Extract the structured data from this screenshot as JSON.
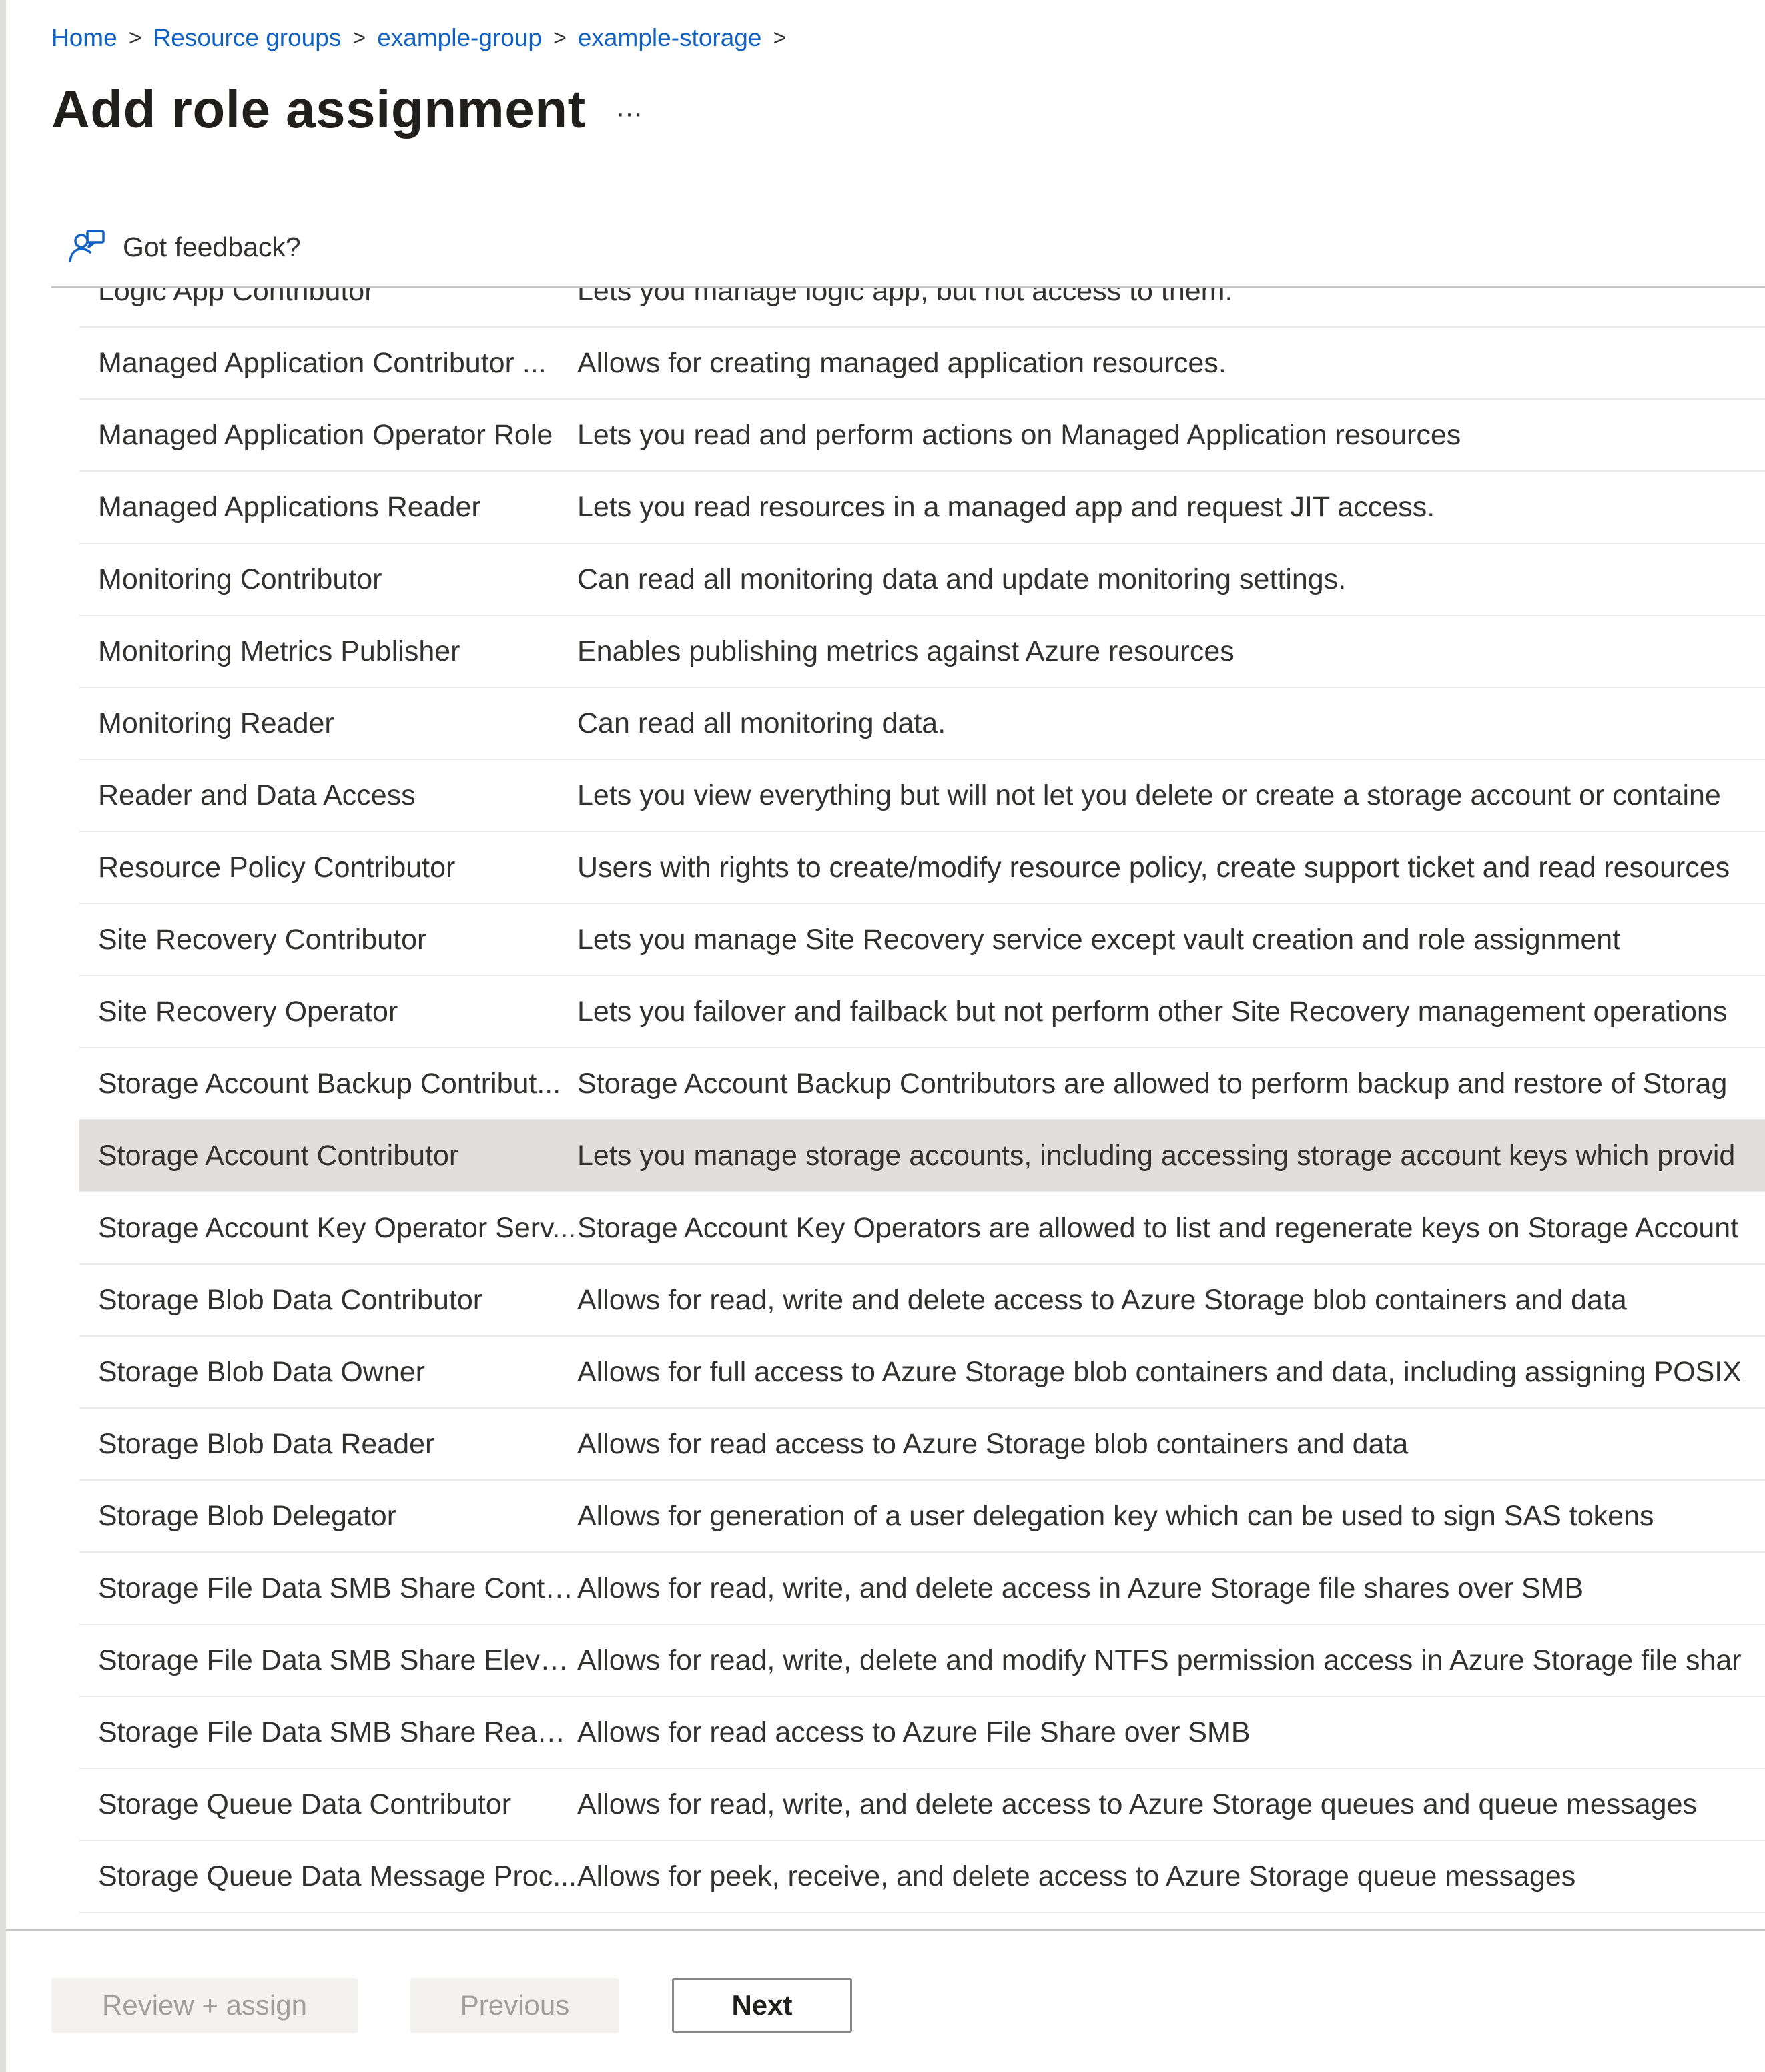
{
  "breadcrumb": {
    "items": [
      "Home",
      "Resource groups",
      "example-group",
      "example-storage"
    ],
    "separator": ">"
  },
  "header": {
    "title": "Add role assignment",
    "more_label": "···"
  },
  "feedback": {
    "label": "Got feedback?",
    "icon": "feedback-person-icon"
  },
  "roles": {
    "selected_index": 12,
    "rows": [
      {
        "name": "Logic App Contributor",
        "description": "Lets you manage logic app, but not access to them."
      },
      {
        "name": "Managed Application Contributor ...",
        "description": "Allows for creating managed application resources."
      },
      {
        "name": "Managed Application Operator Role",
        "description": "Lets you read and perform actions on Managed Application resources"
      },
      {
        "name": "Managed Applications Reader",
        "description": "Lets you read resources in a managed app and request JIT access."
      },
      {
        "name": "Monitoring Contributor",
        "description": "Can read all monitoring data and update monitoring settings."
      },
      {
        "name": "Monitoring Metrics Publisher",
        "description": "Enables publishing metrics against Azure resources"
      },
      {
        "name": "Monitoring Reader",
        "description": "Can read all monitoring data."
      },
      {
        "name": "Reader and Data Access",
        "description": "Lets you view everything but will not let you delete or create a storage account or containe"
      },
      {
        "name": "Resource Policy Contributor",
        "description": "Users with rights to create/modify resource policy, create support ticket and read resources"
      },
      {
        "name": "Site Recovery Contributor",
        "description": "Lets you manage Site Recovery service except vault creation and role assignment"
      },
      {
        "name": "Site Recovery Operator",
        "description": "Lets you failover and failback but not perform other Site Recovery management operations"
      },
      {
        "name": "Storage Account Backup Contribut...",
        "description": "Storage Account Backup Contributors are allowed to perform backup and restore of Storag"
      },
      {
        "name": "Storage Account Contributor",
        "description": "Lets you manage storage accounts, including accessing storage account keys which provid"
      },
      {
        "name": "Storage Account Key Operator Serv...",
        "description": "Storage Account Key Operators are allowed to list and regenerate keys on Storage Account"
      },
      {
        "name": "Storage Blob Data Contributor",
        "description": "Allows for read, write and delete access to Azure Storage blob containers and data"
      },
      {
        "name": "Storage Blob Data Owner",
        "description": "Allows for full access to Azure Storage blob containers and data, including assigning POSIX"
      },
      {
        "name": "Storage Blob Data Reader",
        "description": "Allows for read access to Azure Storage blob containers and data"
      },
      {
        "name": "Storage Blob Delegator",
        "description": "Allows for generation of a user delegation key which can be used to sign SAS tokens"
      },
      {
        "name": "Storage File Data SMB Share Contri...",
        "description": "Allows for read, write, and delete access in Azure Storage file shares over SMB"
      },
      {
        "name": "Storage File Data SMB Share Elevat...",
        "description": "Allows for read, write, delete and modify NTFS permission access in Azure Storage file shar"
      },
      {
        "name": "Storage File Data SMB Share Reader",
        "description": "Allows for read access to Azure File Share over SMB"
      },
      {
        "name": "Storage Queue Data Contributor",
        "description": "Allows for read, write, and delete access to Azure Storage queues and queue messages"
      },
      {
        "name": "Storage Queue Data Message Proc...",
        "description": "Allows for peek, receive, and delete access to Azure Storage queue messages"
      }
    ]
  },
  "footer": {
    "review_assign_label": "Review + assign",
    "previous_label": "Previous",
    "next_label": "Next"
  },
  "colors": {
    "link": "#0f62c4",
    "selected_row": "#e1dfdd",
    "disabled_button_bg": "#f3f2f1",
    "disabled_button_text": "#a19f9d"
  }
}
